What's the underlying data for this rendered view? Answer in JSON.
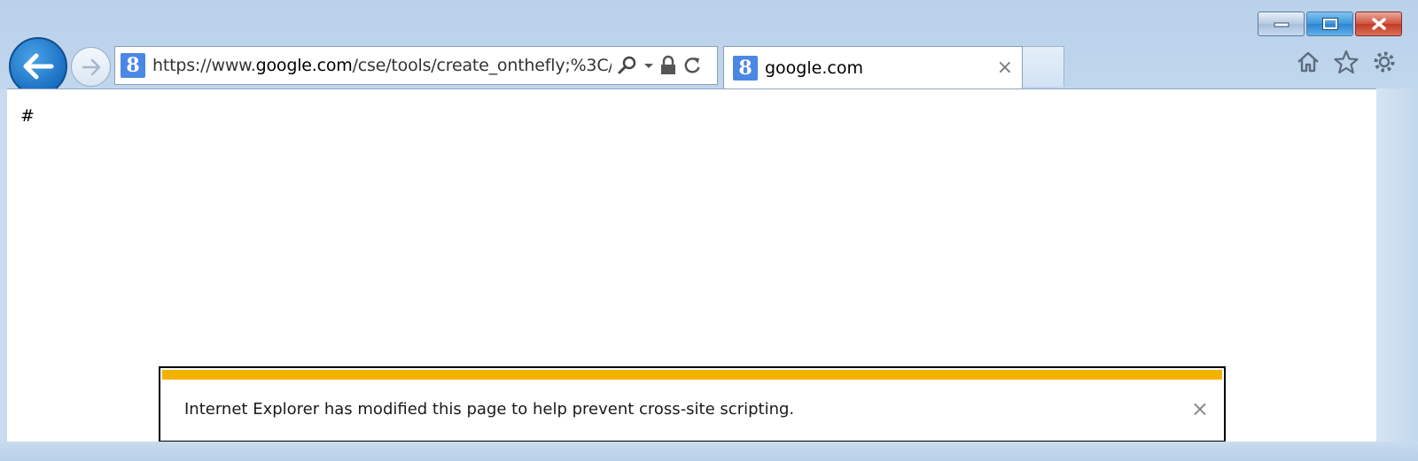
{
  "address_bar": {
    "url_scheme": "https://www.",
    "url_domain": "google.com",
    "url_path": "/cse/tools/create_onthefly;%3C/",
    "favicon_letter": "8"
  },
  "tab": {
    "title": "google.com",
    "favicon_letter": "8",
    "close_glyph": "×"
  },
  "page": {
    "content_text": "#"
  },
  "notification": {
    "message": "Internet Explorer has modified this page to help prevent cross-site scripting.",
    "close_glyph": "×",
    "accent_color": "#f5b100"
  },
  "icons": {
    "back": "back-arrow-icon",
    "forward": "forward-arrow-icon",
    "search": "search-icon",
    "dropdown": "chevron-down-icon",
    "lock": "lock-icon",
    "refresh": "refresh-icon",
    "home": "home-icon",
    "favorites": "star-icon",
    "tools": "gear-icon",
    "minimize": "minimize-icon",
    "maximize": "maximize-icon",
    "close": "close-icon"
  }
}
